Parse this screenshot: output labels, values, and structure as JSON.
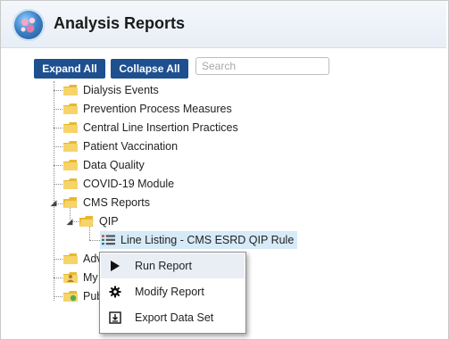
{
  "header": {
    "title": "Analysis Reports"
  },
  "toolbar": {
    "expand_all_label": "Expand All",
    "collapse_all_label": "Collapse All",
    "search_placeholder": "Search"
  },
  "tree": {
    "items": [
      {
        "label": "Dialysis Events"
      },
      {
        "label": "Prevention Process Measures"
      },
      {
        "label": "Central Line Insertion Practices"
      },
      {
        "label": "Patient Vaccination"
      },
      {
        "label": "Data Quality"
      },
      {
        "label": "COVID-19 Module"
      },
      {
        "label": "CMS Reports"
      },
      {
        "label": "QIP"
      },
      {
        "label": "Line Listing - CMS ESRD QIP Rule"
      },
      {
        "label": "Adv"
      },
      {
        "label": "My"
      },
      {
        "label": "Pub"
      }
    ]
  },
  "context_menu": {
    "items": [
      {
        "label": "Run Report",
        "icon": "play-icon"
      },
      {
        "label": "Modify Report",
        "icon": "gear-icon"
      },
      {
        "label": "Export Data Set",
        "icon": "export-icon"
      }
    ]
  },
  "colors": {
    "button_bg": "#1e4f8f",
    "folder": "#f2c443",
    "selection": "#d7eaf8"
  }
}
